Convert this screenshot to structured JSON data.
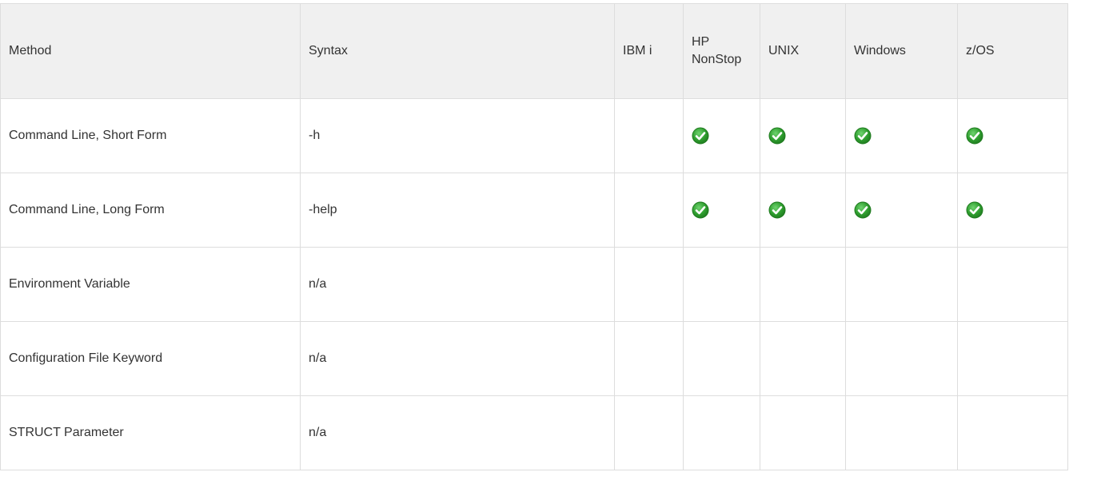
{
  "table": {
    "headers": {
      "method": "Method",
      "syntax": "Syntax",
      "ibmi": "IBM i",
      "hp_nonstop": "HP NonStop",
      "unix": "UNIX",
      "windows": "Windows",
      "zos": "z/OS"
    },
    "rows": [
      {
        "method": "Command Line, Short Form",
        "syntax": "-h",
        "ibmi": false,
        "hp_nonstop": true,
        "unix": true,
        "windows": true,
        "zos": true
      },
      {
        "method": "Command Line, Long Form",
        "syntax": "-help",
        "ibmi": false,
        "hp_nonstop": true,
        "unix": true,
        "windows": true,
        "zos": true
      },
      {
        "method": "Environment Variable",
        "syntax": "n/a",
        "ibmi": false,
        "hp_nonstop": false,
        "unix": false,
        "windows": false,
        "zos": false
      },
      {
        "method": "Configuration File Keyword",
        "syntax": "n/a",
        "ibmi": false,
        "hp_nonstop": false,
        "unix": false,
        "windows": false,
        "zos": false
      },
      {
        "method": "STRUCT Parameter",
        "syntax": "n/a",
        "ibmi": false,
        "hp_nonstop": false,
        "unix": false,
        "windows": false,
        "zos": false
      }
    ],
    "check_icon": "check-icon",
    "colors": {
      "check": "#2e9d2e",
      "check_dark": "#1f7a1f",
      "header_bg": "#f0f0f0",
      "border": "#dddddd"
    }
  }
}
